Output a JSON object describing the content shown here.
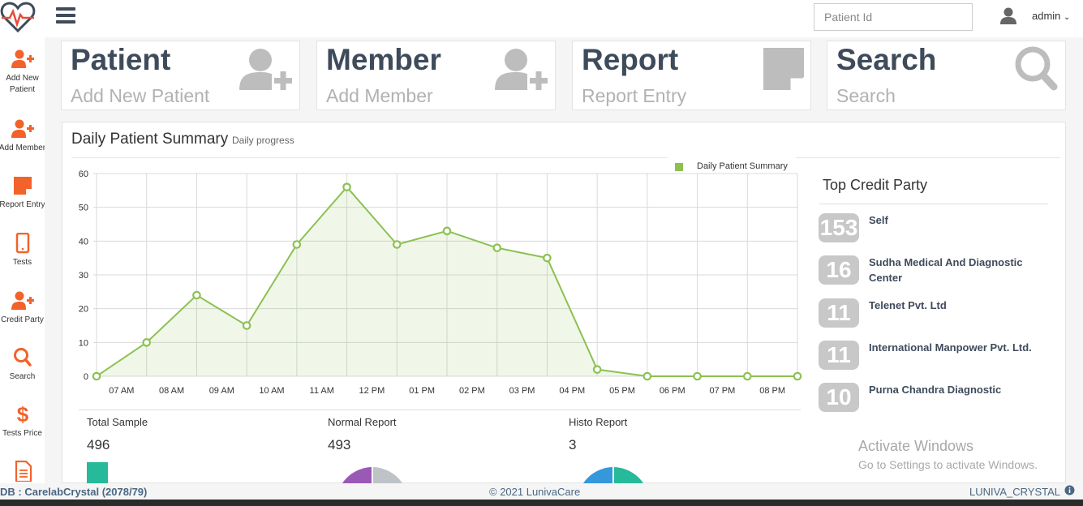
{
  "header": {
    "search_placeholder": "Patient Id",
    "user_label": "admin",
    "logo_icon": "heartbeat-icon",
    "menu_icon": "hamburger-icon"
  },
  "sidebar": {
    "items": [
      {
        "label": "Add New Patient",
        "icon": "add-user-icon"
      },
      {
        "label": "Add Member",
        "icon": "add-user-icon"
      },
      {
        "label": "Report Entry",
        "icon": "note-icon"
      },
      {
        "label": "Tests",
        "icon": "tablet-icon"
      },
      {
        "label": "Credit Party",
        "icon": "add-user-icon"
      },
      {
        "label": "Search",
        "icon": "search-icon"
      },
      {
        "label": "Tests Price",
        "icon": "dollar-icon"
      },
      {
        "label": "",
        "icon": "document-icon"
      }
    ]
  },
  "tiles": [
    {
      "title": "Patient",
      "subtitle": "Add New Patient",
      "icon": "add-user-icon"
    },
    {
      "title": "Member",
      "subtitle": "Add Member",
      "icon": "add-user-icon"
    },
    {
      "title": "Report",
      "subtitle": "Report Entry",
      "icon": "sticky-note-icon"
    },
    {
      "title": "Search",
      "subtitle": "Search",
      "icon": "search-icon"
    }
  ],
  "summary": {
    "title": "Daily Patient Summary",
    "subtitle": "Daily progress"
  },
  "chart_data": {
    "type": "area",
    "title": "",
    "xlabel": "",
    "ylabel": "",
    "x": [
      "07 AM",
      "08 AM",
      "09 AM",
      "10 AM",
      "11 AM",
      "12 PM",
      "01 PM",
      "02 PM",
      "03 PM",
      "04 PM",
      "05 PM",
      "06 PM",
      "07 PM",
      "08 PM"
    ],
    "y_ticks": [
      0,
      10,
      20,
      30,
      40,
      50,
      60
    ],
    "ylim": [
      0,
      60
    ],
    "series": [
      {
        "name": "Daily Patient Summary",
        "color": "#8cc152",
        "values": [
          0,
          10,
          24,
          15,
          39,
          56,
          39,
          43,
          38,
          35,
          2,
          0,
          0,
          0,
          0
        ]
      }
    ],
    "legend_position": "top-right",
    "grid": true
  },
  "stats": [
    {
      "label": "Total Sample",
      "value": "496"
    },
    {
      "label": "Normal Report",
      "value": "493"
    },
    {
      "label": "Histo Report",
      "value": "3"
    }
  ],
  "top_credit": {
    "title": "Top Credit Party",
    "items": [
      {
        "count": "153",
        "name": "Self"
      },
      {
        "count": "16",
        "name": "Sudha Medical And Diagnostic Center"
      },
      {
        "count": "11",
        "name": "Telenet Pvt. Ltd"
      },
      {
        "count": "11",
        "name": "International Manpower Pvt. Ltd."
      },
      {
        "count": "10",
        "name": "Purna Chandra Diagnostic"
      }
    ]
  },
  "watermark": {
    "line1": "Activate Windows",
    "line2": "Go to Settings to activate Windows."
  },
  "footer": {
    "left": "DB : CarelabCrystal (2078/79)",
    "center": "© 2021 LunivaCare",
    "right": "LUNIVA_CRYSTAL"
  },
  "colors": {
    "accent_orange": "#f2622a",
    "series_green": "#8cc152",
    "tile_text": "#3e4b5b",
    "badge_gray": "#c8c8c8"
  }
}
